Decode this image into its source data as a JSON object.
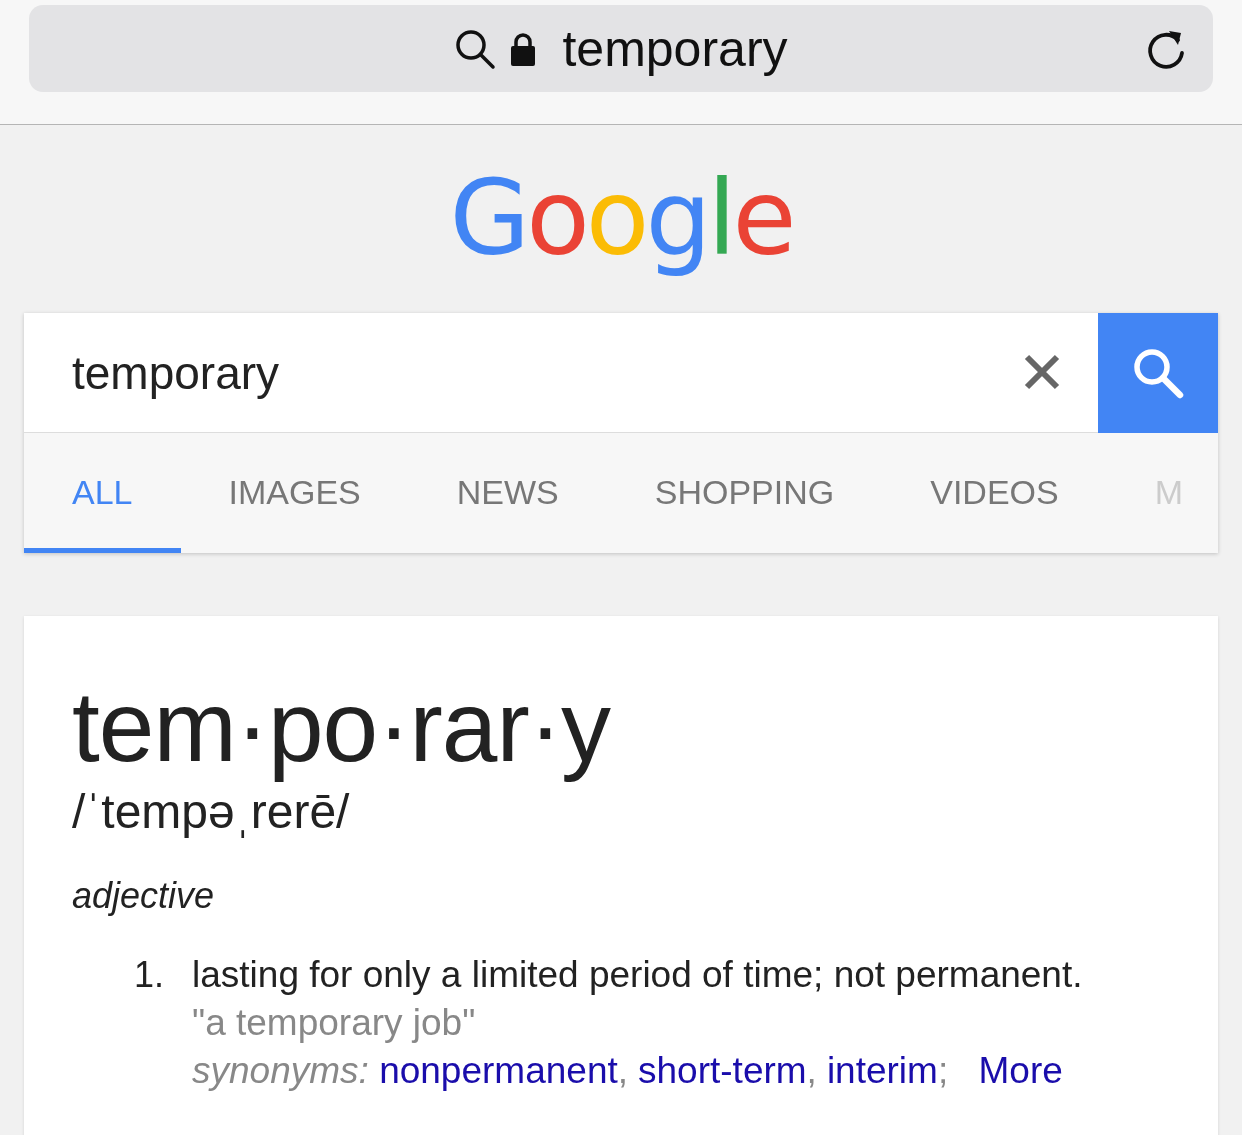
{
  "address_bar": {
    "url": "temporary",
    "secure": true
  },
  "logo": "Google",
  "search": {
    "value": "temporary"
  },
  "tabs": [
    {
      "label": "ALL",
      "selected": true
    },
    {
      "label": "IMAGES",
      "selected": false
    },
    {
      "label": "NEWS",
      "selected": false
    },
    {
      "label": "SHOPPING",
      "selected": false
    },
    {
      "label": "VIDEOS",
      "selected": false
    },
    {
      "label": "M",
      "selected": false
    }
  ],
  "definition": {
    "headword": "tem·po·rar·y",
    "pronunciation": "/ˈtempəˌrerē/",
    "part_of_speech": "adjective",
    "senses": [
      {
        "number": "1.",
        "meaning": "lasting for only a limited period of time; not permanent.",
        "example": "\"a temporary job\"",
        "synonyms_label": "synonyms:",
        "synonyms": [
          {
            "text": "nonpermanent",
            "separator": ","
          },
          {
            "text": "short-term",
            "separator": ","
          },
          {
            "text": "interim",
            "separator": ";"
          }
        ],
        "more": "More"
      }
    ]
  }
}
